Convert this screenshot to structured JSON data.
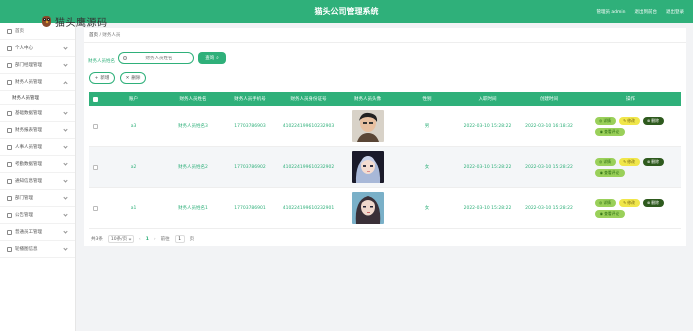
{
  "app": {
    "title": "猫头公司管理系统",
    "logo_text": "猫头鹰源码"
  },
  "topbar": {
    "user_label": "管理员 admin",
    "front_label": "退出到前台",
    "logout_label": "退出登录"
  },
  "sidebar": {
    "items": [
      {
        "label": "首页",
        "icon": "home-icon"
      },
      {
        "label": "个人中心",
        "icon": "user-icon"
      },
      {
        "label": "部门经理管理",
        "icon": "manager-icon"
      },
      {
        "label": "财务人员管理",
        "icon": "finance-icon",
        "open": true,
        "sub": "财务人员管理"
      },
      {
        "label": "基础数据管理",
        "icon": "data-icon"
      },
      {
        "label": "财务报表管理",
        "icon": "report-icon"
      },
      {
        "label": "人事人员管理",
        "icon": "hr-icon"
      },
      {
        "label": "考勤数据管理",
        "icon": "attendance-icon"
      },
      {
        "label": "通知信息管理",
        "icon": "notice-icon"
      },
      {
        "label": "部门管理",
        "icon": "dept-icon"
      },
      {
        "label": "公告管理",
        "icon": "announcement-icon"
      },
      {
        "label": "普通员工管理",
        "icon": "staff-icon"
      },
      {
        "label": "轮播图信息",
        "icon": "carousel-icon"
      }
    ]
  },
  "breadcrumb": {
    "home": "首页",
    "current": "财务人员"
  },
  "search": {
    "label": "财务人员姓名",
    "placeholder": "财务人员姓名",
    "button": "查询"
  },
  "actions": {
    "add": "新增",
    "delete": "删除"
  },
  "table": {
    "headers": [
      "",
      "账户",
      "财务人员姓名",
      "财务人员手机号",
      "财务人员身份证号",
      "财务人员头像",
      "性别",
      "入职时间",
      "创建时间",
      "操作"
    ],
    "rows": [
      {
        "account": "a3",
        "name": "财务人员姓名3",
        "phone": "17703786903",
        "idcard": "410224199610232903",
        "sex": "男",
        "entry": "2022-03-10 15:28:22",
        "created": "2022-03-10 16:18:32",
        "avatar": "male"
      },
      {
        "account": "a2",
        "name": "财务人员姓名2",
        "phone": "17703786902",
        "idcard": "410224199610232902",
        "sex": "女",
        "entry": "2022-03-10 15:28:22",
        "created": "2022-03-10 15:28:22",
        "avatar": "female1"
      },
      {
        "account": "a1",
        "name": "财务人员姓名1",
        "phone": "17703786901",
        "idcard": "410224199610232901",
        "sex": "女",
        "entry": "2022-03-10 15:28:22",
        "created": "2022-03-10 15:28:22",
        "avatar": "female2"
      }
    ],
    "ops": {
      "detail": "详情",
      "edit": "修改",
      "delete": "删除",
      "review": "查看评论"
    }
  },
  "pager": {
    "total": "共3条",
    "page_size": "10条/页",
    "current": "1",
    "goto_label": "前往",
    "goto_value": "1",
    "page_suffix": "页"
  }
}
